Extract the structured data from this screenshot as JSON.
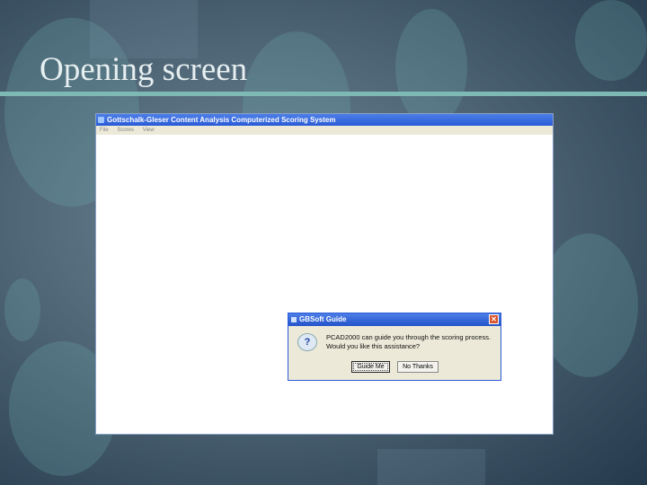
{
  "slide": {
    "title": "Opening screen"
  },
  "window": {
    "title": "Gottschalk-Gleser Content Analysis Computerized Scoring System",
    "menu": [
      "File",
      "Scores",
      "View"
    ]
  },
  "dialog": {
    "title": "GBSoft Guide",
    "line1": "PCAD2000 can guide you through the scoring process.",
    "line2": "Would you like this assistance?",
    "guide_label": "Guide Me",
    "no_label": "No Thanks",
    "close": "✕",
    "icon": "?"
  }
}
